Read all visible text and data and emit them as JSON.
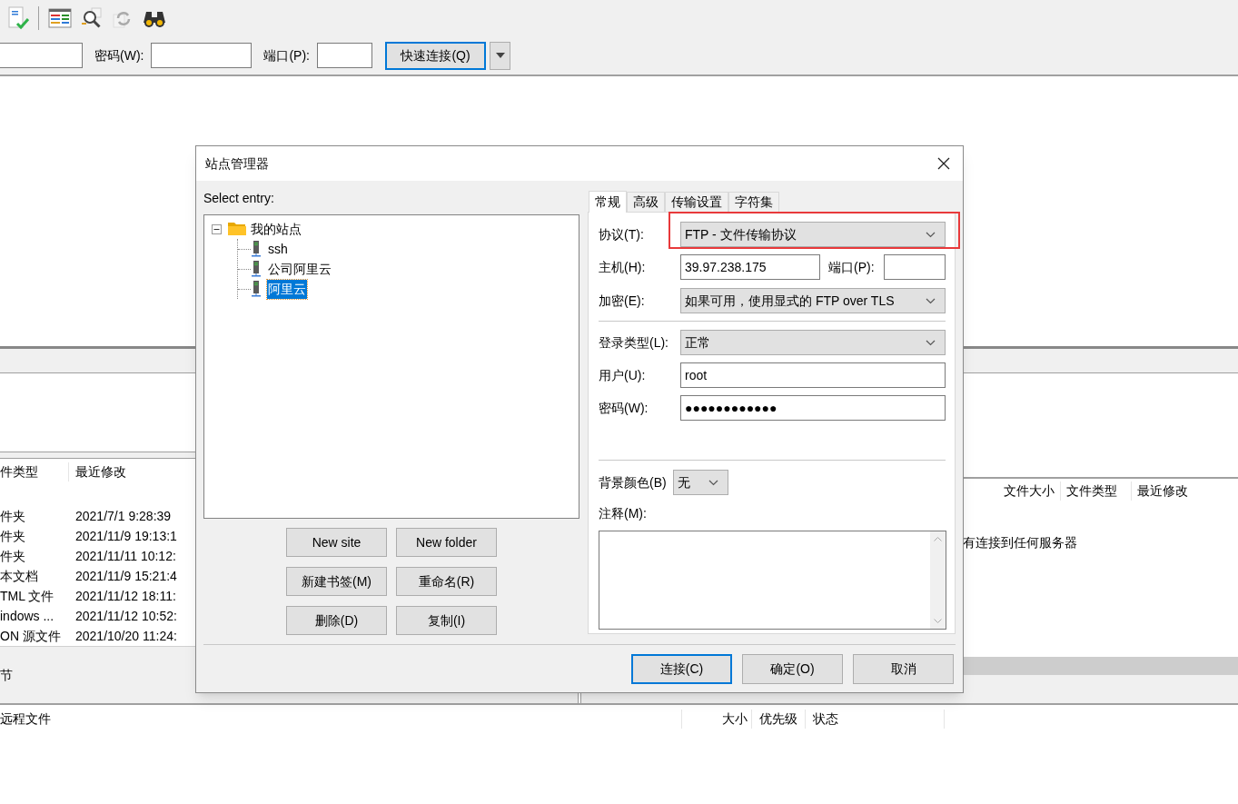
{
  "quickconnect": {
    "password_label": "密码(W):",
    "port_label": "端口(P):",
    "button": "快速连接(Q)"
  },
  "local_pane": {
    "columns": [
      "件类型",
      "最近修改"
    ],
    "rows": [
      {
        "type": "件夹",
        "modified": "2021/7/1 9:28:39"
      },
      {
        "type": "件夹",
        "modified": "2021/11/9 19:13:1"
      },
      {
        "type": "件夹",
        "modified": "2021/11/11 10:12:"
      },
      {
        "type": "本文档",
        "modified": "2021/11/9 15:21:4"
      },
      {
        "type": "TML 文件",
        "modified": "2021/11/12 18:11:"
      },
      {
        "type": "indows ...",
        "modified": "2021/11/12 10:52:"
      },
      {
        "type": "ON 源文件",
        "modified": "2021/10/20 11:24:"
      }
    ],
    "status": "节"
  },
  "remote_pane": {
    "columns": [
      "文件大小",
      "文件类型",
      "最近修改"
    ],
    "message": "有连接到任何服务器"
  },
  "queue": {
    "columns": [
      "远程文件",
      "大小",
      "优先级",
      "状态"
    ]
  },
  "dialog": {
    "title": "站点管理器",
    "select_label": "Select entry:",
    "tree": [
      {
        "label": "我的站点",
        "expanded": true,
        "selected": false,
        "children": [
          {
            "label": "ssh",
            "selected": false
          },
          {
            "label": "公司阿里云",
            "selected": false
          },
          {
            "label": "阿里云",
            "selected": true
          }
        ]
      }
    ],
    "site_buttons": [
      "New site",
      "New folder",
      "新建书签(M)",
      "重命名(R)",
      "删除(D)",
      "复制(I)"
    ],
    "tabs": [
      {
        "label": "常规",
        "selected": true
      },
      {
        "label": "高级",
        "selected": false
      },
      {
        "label": "传输设置",
        "selected": false
      },
      {
        "label": "字符集",
        "selected": false
      }
    ],
    "form": {
      "protocol": {
        "label": "协议(T):",
        "value": "FTP - 文件传输协议",
        "highlighted": true
      },
      "host": {
        "label": "主机(H):",
        "value": "39.97.238.175"
      },
      "port": {
        "label": "端口(P):"
      },
      "encryption": {
        "label": "加密(E):",
        "value": "如果可用，使用显式的 FTP over TLS"
      },
      "login_type": {
        "label": "登录类型(L):",
        "value": "正常"
      },
      "user": {
        "label": "用户(U):",
        "value": "root"
      },
      "password": {
        "label": "密码(W):",
        "value": "●●●●●●●●●●●●"
      },
      "background_color": {
        "label": "背景颜色(B)",
        "value": "无"
      },
      "comments": {
        "label": "注释(M):"
      }
    },
    "buttons": [
      {
        "label": "连接(C)",
        "default": true
      },
      {
        "label": "确定(O)",
        "default": false
      },
      {
        "label": "取消",
        "default": false
      }
    ]
  }
}
